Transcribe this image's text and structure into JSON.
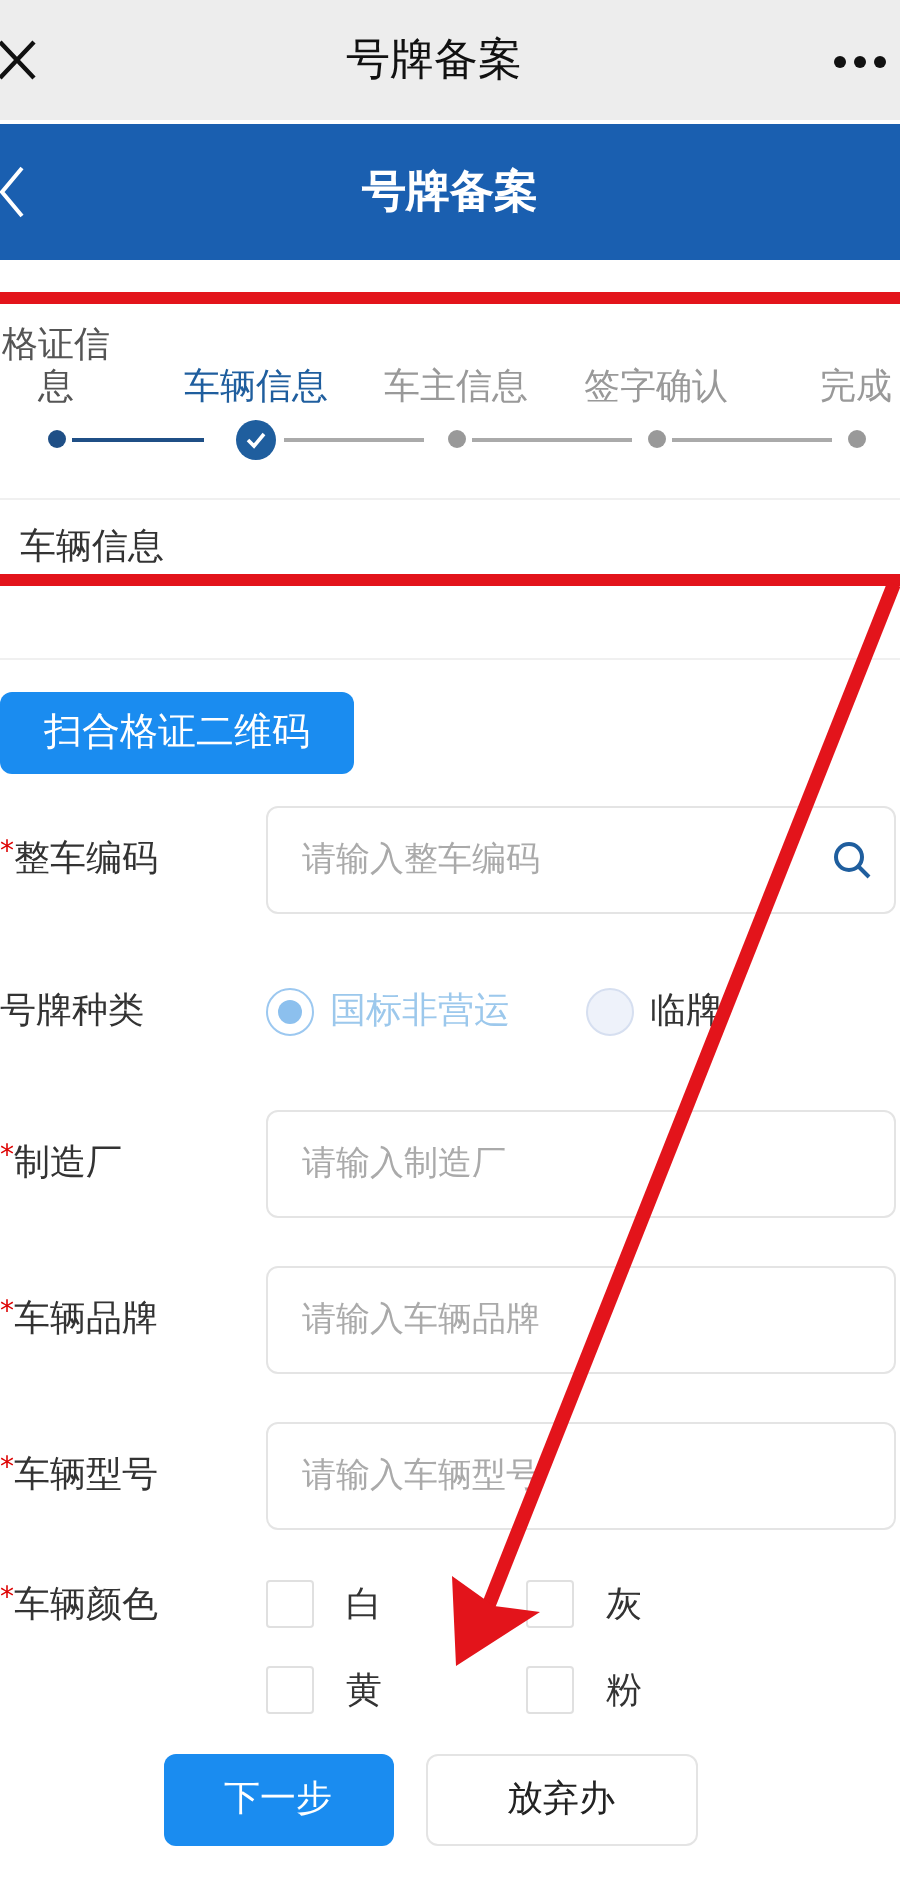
{
  "app_bar": {
    "title": "号牌备案"
  },
  "header": {
    "title": "号牌备案"
  },
  "steps": [
    {
      "label": "格证信息",
      "done": true,
      "selected": false
    },
    {
      "label": "车辆信息",
      "done": false,
      "selected": true
    },
    {
      "label": "车主信息",
      "done": false,
      "selected": false
    },
    {
      "label": "签字确认",
      "done": false,
      "selected": false
    },
    {
      "label": "完成",
      "done": false,
      "selected": false
    }
  ],
  "section_title": "车辆信息",
  "scan_button": "扫合格证二维码",
  "form": [
    {
      "kind": "input",
      "required_mark": "*",
      "label": "整车编码",
      "placeholder": "请输入整车编码",
      "search": true
    },
    {
      "kind": "radio",
      "label": "号牌种类",
      "options": [
        {
          "label": "国标非营运",
          "selected": true
        },
        {
          "label": "临牌",
          "selected": false
        }
      ]
    },
    {
      "kind": "input",
      "required_mark": "*",
      "label": "制造厂",
      "placeholder": "请输入制造厂"
    },
    {
      "kind": "input",
      "required_mark": "*",
      "label": "车辆品牌",
      "placeholder": "请输入车辆品牌"
    },
    {
      "kind": "input",
      "required_mark": "*",
      "label": "车辆型号",
      "placeholder": "请输入车辆型号"
    },
    {
      "kind": "checkbox",
      "required_mark": "*",
      "label": "车辆颜色",
      "options": [
        {
          "label": "白",
          "checked": false
        },
        {
          "label": "灰",
          "checked": false
        },
        {
          "label": "黄",
          "checked": false
        },
        {
          "label": "粉",
          "checked": false
        }
      ]
    }
  ],
  "buttons": [
    {
      "label": "下一步",
      "kind": "primary"
    },
    {
      "label": "放弃办",
      "kind": "secondary"
    }
  ]
}
